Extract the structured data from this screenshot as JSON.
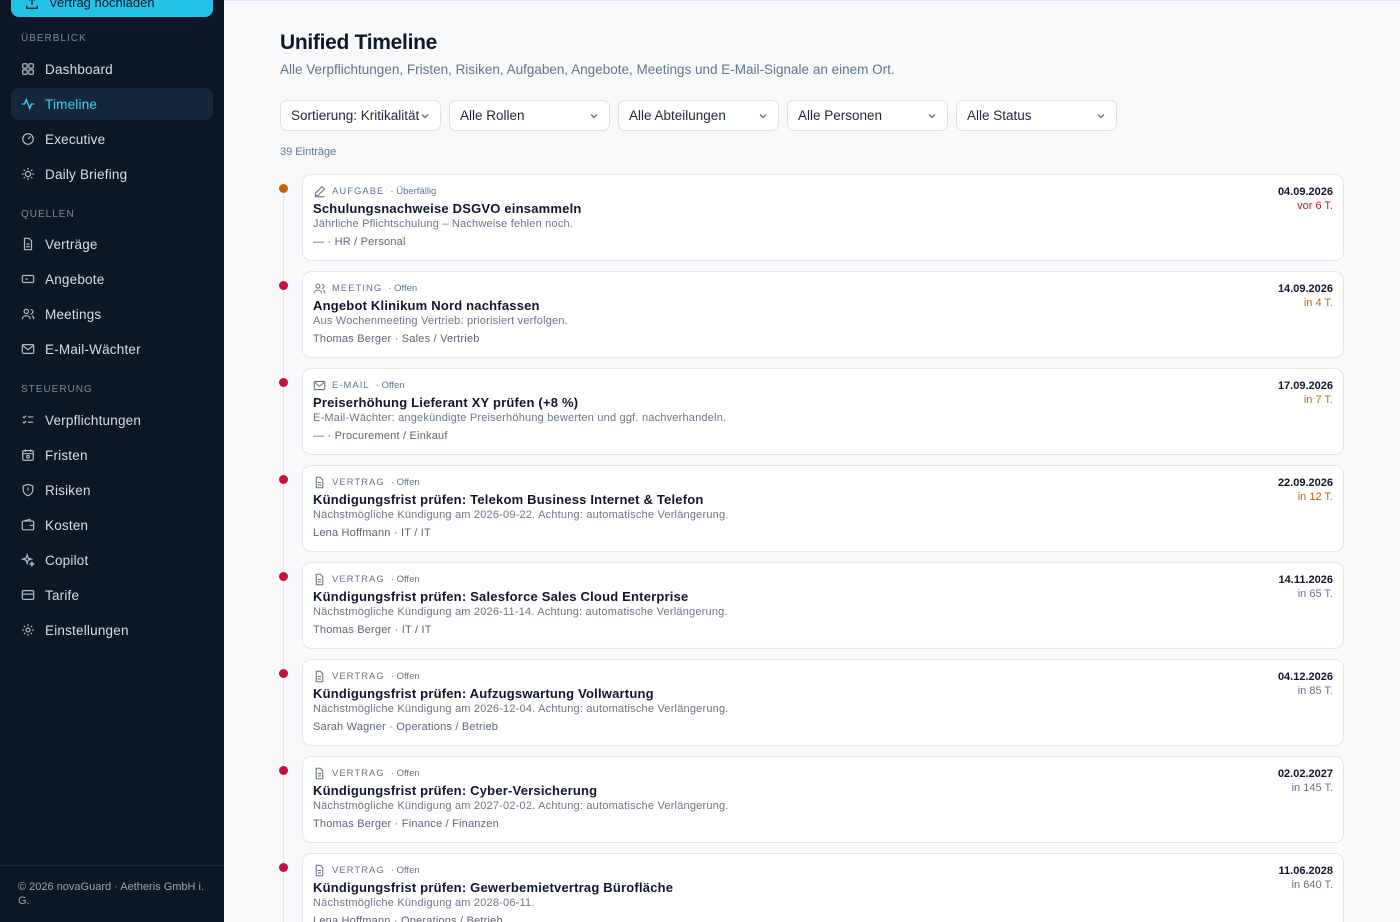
{
  "sidebar": {
    "upload_label": "Vertrag hochladen",
    "sections": {
      "overview": "ÜBERBLICK",
      "sources": "QUELLEN",
      "control": "STEUERUNG"
    },
    "items": [
      {
        "label": "Dashboard",
        "icon": "grid-icon"
      },
      {
        "label": "Timeline",
        "icon": "activity-icon",
        "active": true
      },
      {
        "label": "Executive",
        "icon": "gauge-icon"
      },
      {
        "label": "Daily Briefing",
        "icon": "sun-icon"
      },
      {
        "label": "Verträge",
        "icon": "file-icon"
      },
      {
        "label": "Angebote",
        "icon": "receipt-icon"
      },
      {
        "label": "Meetings",
        "icon": "users-icon"
      },
      {
        "label": "E-Mail-Wächter",
        "icon": "mail-icon"
      },
      {
        "label": "Verpflichtungen",
        "icon": "checklist-icon"
      },
      {
        "label": "Fristen",
        "icon": "calendar-icon"
      },
      {
        "label": "Risiken",
        "icon": "shield-icon"
      },
      {
        "label": "Kosten",
        "icon": "wallet-icon"
      },
      {
        "label": "Copilot",
        "icon": "sparkles-icon"
      },
      {
        "label": "Tarife",
        "icon": "credit-card-icon"
      },
      {
        "label": "Einstellungen",
        "icon": "gear-icon"
      }
    ],
    "footer": "© 2026 novaGuard · Aetheris GmbH i. G."
  },
  "header": {
    "title": "Unified Timeline",
    "subtitle": "Alle Verpflichtungen, Fristen, Risiken, Aufgaben, Angebote, Meetings und E-Mail-Signale an einem Ort."
  },
  "filters": {
    "sort": "Sortierung: Kritikalität",
    "roles": "Alle Rollen",
    "departments": "Alle Abteilungen",
    "persons": "Alle Personen",
    "status": "Alle Status"
  },
  "count": "39 Einträge",
  "colors": {
    "accent": "#22c3e6",
    "overdue_dot": "#c2650a",
    "critical_dot": "#c0123c",
    "overdue_text": "#c0123c",
    "soon_text": "#c2650a",
    "normal_text": "#64748b"
  },
  "entries": [
    {
      "type": "AUFGABE",
      "icon": "pencil-icon",
      "status": "· Überfällig",
      "title": "Schulungsnachweise DSGVO einsammeln",
      "desc": "Jährliche Pflichtschulung – Nachweise fehlen noch.",
      "owner": "— · HR / Personal",
      "date": "04.09.2026",
      "relative": "vor 6 T.",
      "urgency": "overdue"
    },
    {
      "type": "MEETING",
      "icon": "users-icon",
      "status": "· Offen",
      "title": "Angebot Klinikum Nord nachfassen",
      "desc": "Aus Wochenmeeting Vertrieb: priorisiert verfolgen.",
      "owner": "Thomas Berger · Sales / Vertrieb",
      "date": "14.09.2026",
      "relative": "in 4 T.",
      "urgency": "soon"
    },
    {
      "type": "E-MAIL",
      "icon": "mail-icon",
      "status": "· Offen",
      "title": "Preiserhöhung Lieferant XY prüfen (+8 %)",
      "desc": "E-Mail-Wächter: angekündigte Preiserhöhung bewerten und ggf. nachverhandeln.",
      "owner": "— · Procurement / Einkauf",
      "date": "17.09.2026",
      "relative": "in 7 T.",
      "urgency": "soon"
    },
    {
      "type": "VERTRAG",
      "icon": "file-icon",
      "status": "· Offen",
      "title": "Kündigungsfrist prüfen: Telekom Business Internet & Telefon",
      "desc": "Nächstmögliche Kündigung am 2026-09-22. Achtung: automatische Verlängerung.",
      "owner": "Lena Hoffmann · IT / IT",
      "date": "22.09.2026",
      "relative": "in 12 T.",
      "urgency": "soon"
    },
    {
      "type": "VERTRAG",
      "icon": "file-icon",
      "status": "· Offen",
      "title": "Kündigungsfrist prüfen: Salesforce Sales Cloud Enterprise",
      "desc": "Nächstmögliche Kündigung am 2026-11-14. Achtung: automatische Verlängerung.",
      "owner": "Thomas Berger · IT / IT",
      "date": "14.11.2026",
      "relative": "in 65 T.",
      "urgency": "normal"
    },
    {
      "type": "VERTRAG",
      "icon": "file-icon",
      "status": "· Offen",
      "title": "Kündigungsfrist prüfen: Aufzugswartung Vollwartung",
      "desc": "Nächstmögliche Kündigung am 2026-12-04. Achtung: automatische Verlängerung.",
      "owner": "Sarah Wagner · Operations / Betrieb",
      "date": "04.12.2026",
      "relative": "in 85 T.",
      "urgency": "normal"
    },
    {
      "type": "VERTRAG",
      "icon": "file-icon",
      "status": "· Offen",
      "title": "Kündigungsfrist prüfen: Cyber-Versicherung",
      "desc": "Nächstmögliche Kündigung am 2027-02-02. Achtung: automatische Verlängerung.",
      "owner": "Thomas Berger · Finance / Finanzen",
      "date": "02.02.2027",
      "relative": "in 145 T.",
      "urgency": "normal"
    },
    {
      "type": "VERTRAG",
      "icon": "file-icon",
      "status": "· Offen",
      "title": "Kündigungsfrist prüfen: Gewerbemietvertrag Bürofläche",
      "desc": "Nächstmögliche Kündigung am 2028-06-11.",
      "owner": "Lena Hoffmann · Operations / Betrieb",
      "date": "11.06.2028",
      "relative": "in 640 T.",
      "urgency": "normal"
    }
  ]
}
